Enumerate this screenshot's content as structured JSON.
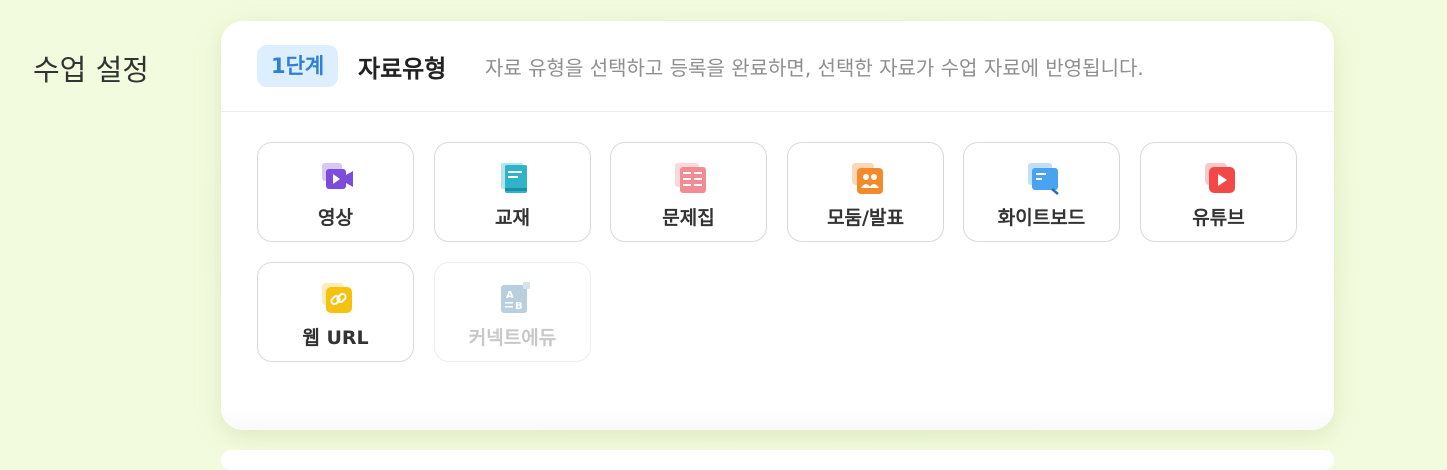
{
  "page": {
    "section_title": "수업 설정"
  },
  "step": {
    "badge": "1단계",
    "title": "자료유형",
    "description": "자료 유형을 선택하고 등록을 완료하면, 선택한 자료가 수업 자료에 반영됩니다."
  },
  "materials": [
    {
      "label": "영상",
      "icon": "video-icon",
      "color": "#7c4ddb",
      "enabled": true
    },
    {
      "label": "교재",
      "icon": "textbook-icon",
      "color": "#2fb3c8",
      "enabled": true
    },
    {
      "label": "문제집",
      "icon": "workbook-icon",
      "color": "#f18c94",
      "enabled": true
    },
    {
      "label": "모둠/발표",
      "icon": "group-icon",
      "color": "#f58a2a",
      "enabled": true
    },
    {
      "label": "화이트보드",
      "icon": "whiteboard-icon",
      "color": "#4aa3f0",
      "enabled": true
    },
    {
      "label": "유튜브",
      "icon": "youtube-icon",
      "color": "#f24848",
      "enabled": true
    },
    {
      "label": "웹 URL",
      "icon": "link-icon",
      "color": "#f5c20f",
      "enabled": true
    },
    {
      "label": "커넥트에듀",
      "icon": "connect-edu-icon",
      "color": "#b9cfe0",
      "enabled": false
    }
  ]
}
